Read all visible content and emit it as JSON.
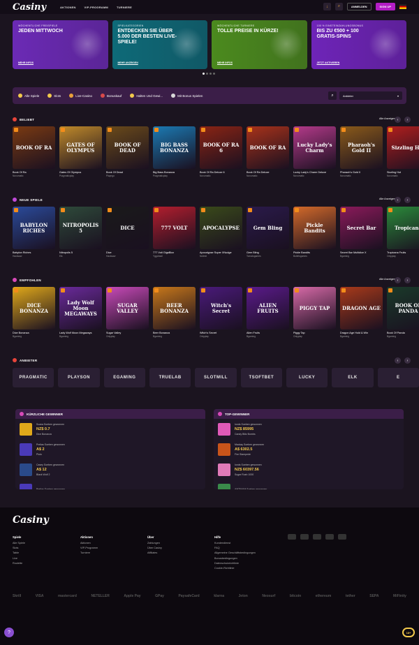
{
  "header": {
    "logo": "Casiny",
    "nav": [
      "AKTIONEN",
      "VIP-PROGRAMM",
      "TURNIERE"
    ],
    "login": "ANMELDEN",
    "signup": "SIGN UP"
  },
  "banners": [
    {
      "sub": "WÖCHENTLICHE FREISPIELE",
      "title": "JEDEN MITTWOCH",
      "more": "MEHR INFOS",
      "bg": "#6b2ab5"
    },
    {
      "sub": "SPIELKATEGORIEN",
      "title": "ENTDECKEN SIE ÜBER 5.000 DER BESTEN LIVE-SPIELE!",
      "more": "MEHR ANZEIGEN",
      "bg": "#0e6a78"
    },
    {
      "sub": "WÖCHENTLICHE TURNIERE",
      "title": "TOLLE PREISE IN KÜRZE!",
      "more": "MEHR INFOS",
      "bg": "#4b8a1e"
    },
    {
      "sub": "100 % EINSTEINZAHLUNGSBONUS",
      "title": "BIS ZU €500 + 100 GRATIS-SPINS",
      "more": "JETZT AKTIVIEREN",
      "bg": "#6e24b8"
    }
  ],
  "filter": {
    "items": [
      "Alle Spiele",
      "Slots",
      "Live-Casino",
      "Bonuskauf",
      "Halten Und Gewi...",
      "Mit Bonus Spielen"
    ],
    "select": "Anbieter"
  },
  "sections": [
    {
      "title": "BELIEBT",
      "all": "Alle Anzeigen",
      "icon_color": "#e8443a",
      "games": [
        {
          "name": "Book Of Ra",
          "provider": "Novomatic",
          "art": "BOOK OF RA",
          "bg": "#7a3a12"
        },
        {
          "name": "Gates Of Olympus",
          "provider": "Pragmaticplay",
          "art": "GATES OF OLYMPUS",
          "bg": "#c08a2a"
        },
        {
          "name": "Book Of Dead",
          "provider": "Playngo",
          "art": "BOOK OF DEAD",
          "bg": "#6a4a1a"
        },
        {
          "name": "Big Bass Bonanza",
          "provider": "Pragmaticplay",
          "art": "BIG BASS BONANZA",
          "bg": "#1b7ab3"
        },
        {
          "name": "Book Of Ra Deluxe 6",
          "provider": "Novomatic",
          "art": "BOOK OF RA 6",
          "bg": "#8a2414"
        },
        {
          "name": "Book Of Ra Deluxe",
          "provider": "Novomatic",
          "art": "BOOK OF RA",
          "bg": "#a8321a"
        },
        {
          "name": "Lucky Lady's Charm Deluxe",
          "provider": "Novomatic",
          "art": "Lucky Lady's Charm",
          "bg": "#b43a8a"
        },
        {
          "name": "Pharaoh's Gold II",
          "provider": "Novomatic",
          "art": "Pharaoh's Gold II",
          "bg": "#8a5a1a"
        },
        {
          "name": "Sizzling Hot",
          "provider": "Novomatic",
          "art": "Sizzling Hot",
          "bg": "#b01e1e"
        }
      ]
    },
    {
      "title": "NEUE SPIELE",
      "all": "Alle Anzeigen",
      "icon_color": "#c04ad8",
      "games": [
        {
          "name": "Babylon Riches",
          "provider": "Hacksaw",
          "art": "BABYLON RICHES",
          "bg": "#2a4a9a"
        },
        {
          "name": "Nitropolis 5",
          "provider": "Elk",
          "art": "NITROPOLIS 5",
          "bg": "#2e4a3a"
        },
        {
          "name": "Dice",
          "provider": "Hacksaw",
          "art": "DICE",
          "bg": "#1a1a1a"
        },
        {
          "name": "777 Volt GigaBlox",
          "provider": "Yggdrasil",
          "art": "777 VOLT",
          "bg": "#b31e2e"
        },
        {
          "name": "Apocalypse Super XNudge",
          "provider": "Nolimit",
          "art": "APOCALYPSE",
          "bg": "#3a4a1a"
        },
        {
          "name": "Gem Bling",
          "provider": "Tomatogames",
          "art": "Gem Bling",
          "bg": "#2a1a4a"
        },
        {
          "name": "Pickle Bandits",
          "provider": "Bulletsgames",
          "art": "Pickle Bandits",
          "bg": "#d46a2a"
        },
        {
          "name": "Secret Bar Multidice X",
          "provider": "Bgaming",
          "art": "Secret Bar",
          "bg": "#8a1a5a"
        },
        {
          "name": "Tropicana Fruits",
          "provider": "Onlyplay",
          "art": "Tropicana",
          "bg": "#2a8a3a"
        }
      ]
    },
    {
      "title": "EMPFOHLEN",
      "all": "Alle Anzeigen",
      "icon_color": "#d84ab8",
      "games": [
        {
          "name": "Dice Bonanza",
          "provider": "Bgaming",
          "art": "DICE BONANZA",
          "bg": "#e0a81a"
        },
        {
          "name": "Lady Wolf Moon Megaways",
          "provider": "Bgaming",
          "art": "Lady Wolf Moon MEGAWAYS",
          "bg": "#6a2a9a"
        },
        {
          "name": "Sugar Valley",
          "provider": "Onlyplay",
          "art": "SUGAR VALLEY",
          "bg": "#c84ab8"
        },
        {
          "name": "Beer Bonanza",
          "provider": "Bgaming",
          "art": "BEER BONANZA",
          "bg": "#c8781a"
        },
        {
          "name": "Witch's Secret",
          "provider": "Onlyplay",
          "art": "Witch's Secret",
          "bg": "#4a1a7a"
        },
        {
          "name": "Alien Fruits",
          "provider": "Bgaming",
          "art": "ALIEN FRUITS",
          "bg": "#5a1a8a"
        },
        {
          "name": "Piggy Tap",
          "provider": "Onlyplay",
          "art": "PIGGY TAP",
          "bg": "#d86aa8"
        },
        {
          "name": "Dragon Age Hold & Win",
          "provider": "Bgaming",
          "art": "DRAGON AGE",
          "bg": "#a83a1a"
        },
        {
          "name": "Book Of Panda",
          "provider": "Bgaming",
          "art": "BOOK OF PANDA",
          "bg": "#1a3a2a"
        }
      ]
    }
  ],
  "providers": {
    "title": "ANBIETER",
    "items": [
      "PRAGMATIC",
      "PLAYSON",
      "EGAMING",
      "TRUELAB",
      "SLOTMILL",
      "TSOFTBET",
      "LUCKY",
      "ELK",
      "E"
    ]
  },
  "recent": {
    "title": "KÜRZLICHE GEWINNER",
    "rows": [
      {
        "who": "Scana Soeben gewonnen",
        "amount": "NZ$ 0.7",
        "game": "Dice Bonanza",
        "bg": "#e0a81a"
      },
      {
        "who": "Prelias Soeben gewonnen",
        "amount": "A$ 2",
        "game": "Pluto",
        "bg": "#4a3ab8"
      },
      {
        "who": "Casey Soeben gewonnen",
        "amount": "A$ 12",
        "game": "Black Wolf 2",
        "bg": "#2a4a8a"
      },
      {
        "who": "Prelias Soeben gewonnen",
        "amount": "",
        "game": "",
        "bg": "#4a3ab8"
      }
    ]
  },
  "top": {
    "title": "TOP-GEWINNER",
    "rows": [
      {
        "who": "Ionds Soeben gewonnen",
        "amount": "NZ$ 85995",
        "game": "Candy Blitz Bombs",
        "bg": "#e05ab8"
      },
      {
        "who": "Mackay Soeben gewonnen",
        "amount": "A$ 6302.5",
        "game": "Fire Stampede",
        "bg": "#c8541a"
      },
      {
        "who": "Ionds Soeben gewonnen",
        "amount": "NZ$ 60397.56",
        "game": "Sugar Rush 1000",
        "bg": "#e07ab8"
      },
      {
        "who": "AMTINAM Soeben gewonnen",
        "amount": "",
        "game": "",
        "bg": "#3a8a4a"
      }
    ]
  },
  "footer": {
    "logo": "Casiny",
    "cols": [
      {
        "h": "Spiele",
        "items": [
          "Alle Spiele",
          "Slots",
          "Table",
          "Live",
          "Roulette"
        ]
      },
      {
        "h": "Aktionen",
        "items": [
          "Aktionen",
          "VIP-Programm",
          "Turniere"
        ]
      },
      {
        "h": "Über",
        "items": [
          "Zahlungen",
          "Über Casiny",
          "Affiliates"
        ]
      },
      {
        "h": "Hilfe",
        "items": [
          "Kundendienst",
          "FAQ",
          "Allgemeine Geschäftsbedingungen",
          "Bonusbedingungen",
          "Datenschutzrichtlinie",
          "Cookie-Richtlinie"
        ]
      }
    ],
    "pay": [
      "Skrill",
      "VISA",
      "mastercard",
      "NETELLER",
      "Apple Pay",
      "GPay",
      "PaysafeCard",
      "klarna",
      "Jeton",
      "Neosurf",
      "bitcoin",
      "ethereum",
      "tether",
      "SEPA",
      "MiFinity"
    ],
    "age": "18+"
  }
}
